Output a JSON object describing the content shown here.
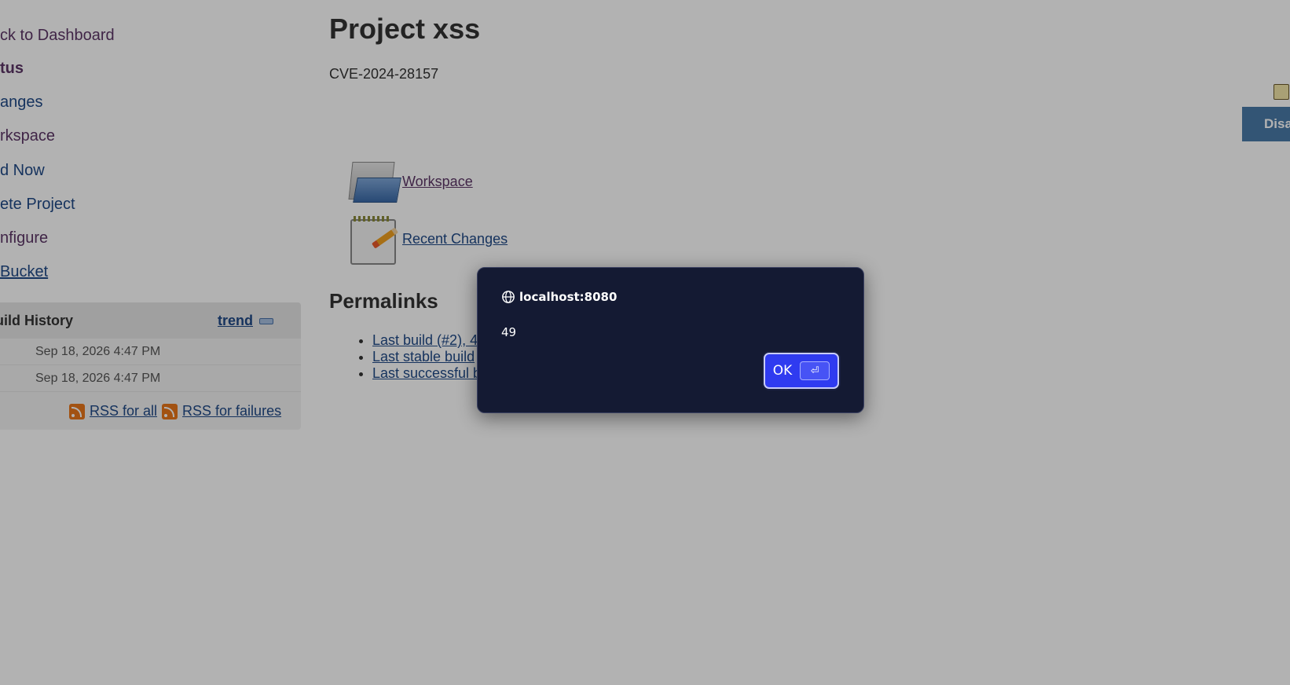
{
  "sidebar": {
    "tasks": [
      {
        "label": "ck to Dashboard"
      },
      {
        "label": "tus"
      },
      {
        "label": "anges"
      },
      {
        "label": "rkspace"
      },
      {
        "label": "d Now"
      },
      {
        "label": "ete Project"
      },
      {
        "label": "nfigure"
      },
      {
        "label": "Bucket"
      }
    ],
    "build_history": {
      "title": "uild History",
      "trend_label": "trend",
      "rows": [
        {
          "timestamp": "Sep 18, 2026 4:47 PM"
        },
        {
          "timestamp": "Sep 18, 2026 4:47 PM"
        }
      ],
      "rss_all_label": "RSS for all",
      "rss_failures_label": "RSS for failures"
    }
  },
  "main": {
    "title": "Project xss",
    "description": "CVE-2024-28157",
    "workspace_link": "Workspace",
    "recent_changes_link": "Recent Changes",
    "permalinks_title": "Permalinks",
    "permalinks": [
      {
        "label": "Last build (#2), 4"
      },
      {
        "label": "Last stable build"
      },
      {
        "label": "Last successful b"
      }
    ]
  },
  "right_panel": {
    "disable_label": "Disa"
  },
  "dialog": {
    "origin": "localhost:8080",
    "message": "49",
    "ok_label": "OK",
    "ok_shortcut": "⏎"
  },
  "colors": {
    "link": "#204a87",
    "visited_link": "#5c3566",
    "dialog_background": "#141a33",
    "ok_button": "#2f3bf0"
  }
}
